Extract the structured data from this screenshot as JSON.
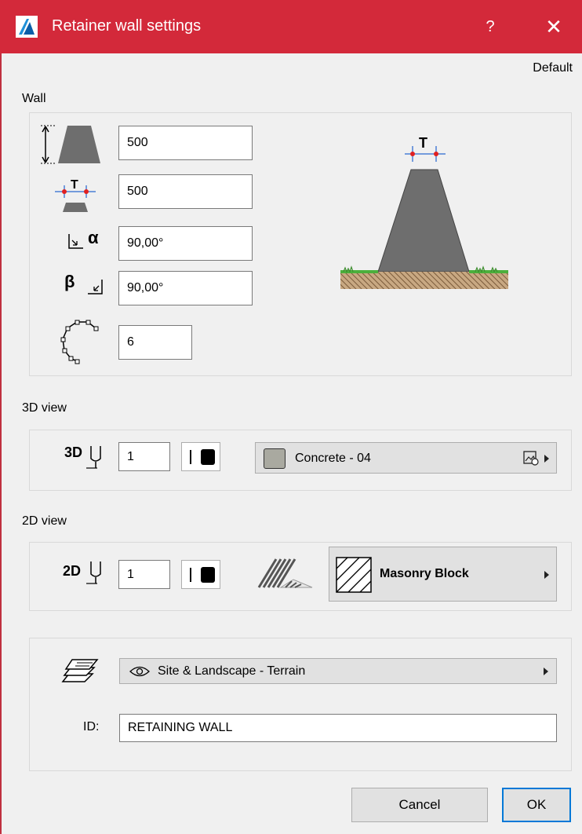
{
  "window": {
    "title": "Retainer wall settings",
    "help_label": "?",
    "close_label": "✕",
    "preset_label": "Default"
  },
  "wall": {
    "section_label": "Wall",
    "height_value": "500",
    "top_thickness_value": "500",
    "alpha_angle_value": "90,00°",
    "beta_angle_value": "90,00°",
    "segments_value": "6",
    "alpha_symbol": "α",
    "beta_symbol": "β",
    "thickness_symbol": "T"
  },
  "view3d": {
    "section_label": "3D view",
    "pen_prefix": "3D",
    "pen_value": "1",
    "surface_label": "Concrete - 04",
    "surface_color": "#a9a9a0"
  },
  "view2d": {
    "section_label": "2D view",
    "pen_prefix": "2D",
    "pen_value": "1",
    "fill_label": "Masonry Block"
  },
  "layer": {
    "label": "Site & Landscape - Terrain",
    "id_label": "ID:",
    "id_value": "RETAINING WALL"
  },
  "buttons": {
    "cancel": "Cancel",
    "ok": "OK"
  },
  "colors": {
    "titlebar": "#d3293a",
    "accent": "#0078d7",
    "wall_fill": "#6e6e6e",
    "ground": "#8b6a4a",
    "grass": "#4caf3c"
  }
}
